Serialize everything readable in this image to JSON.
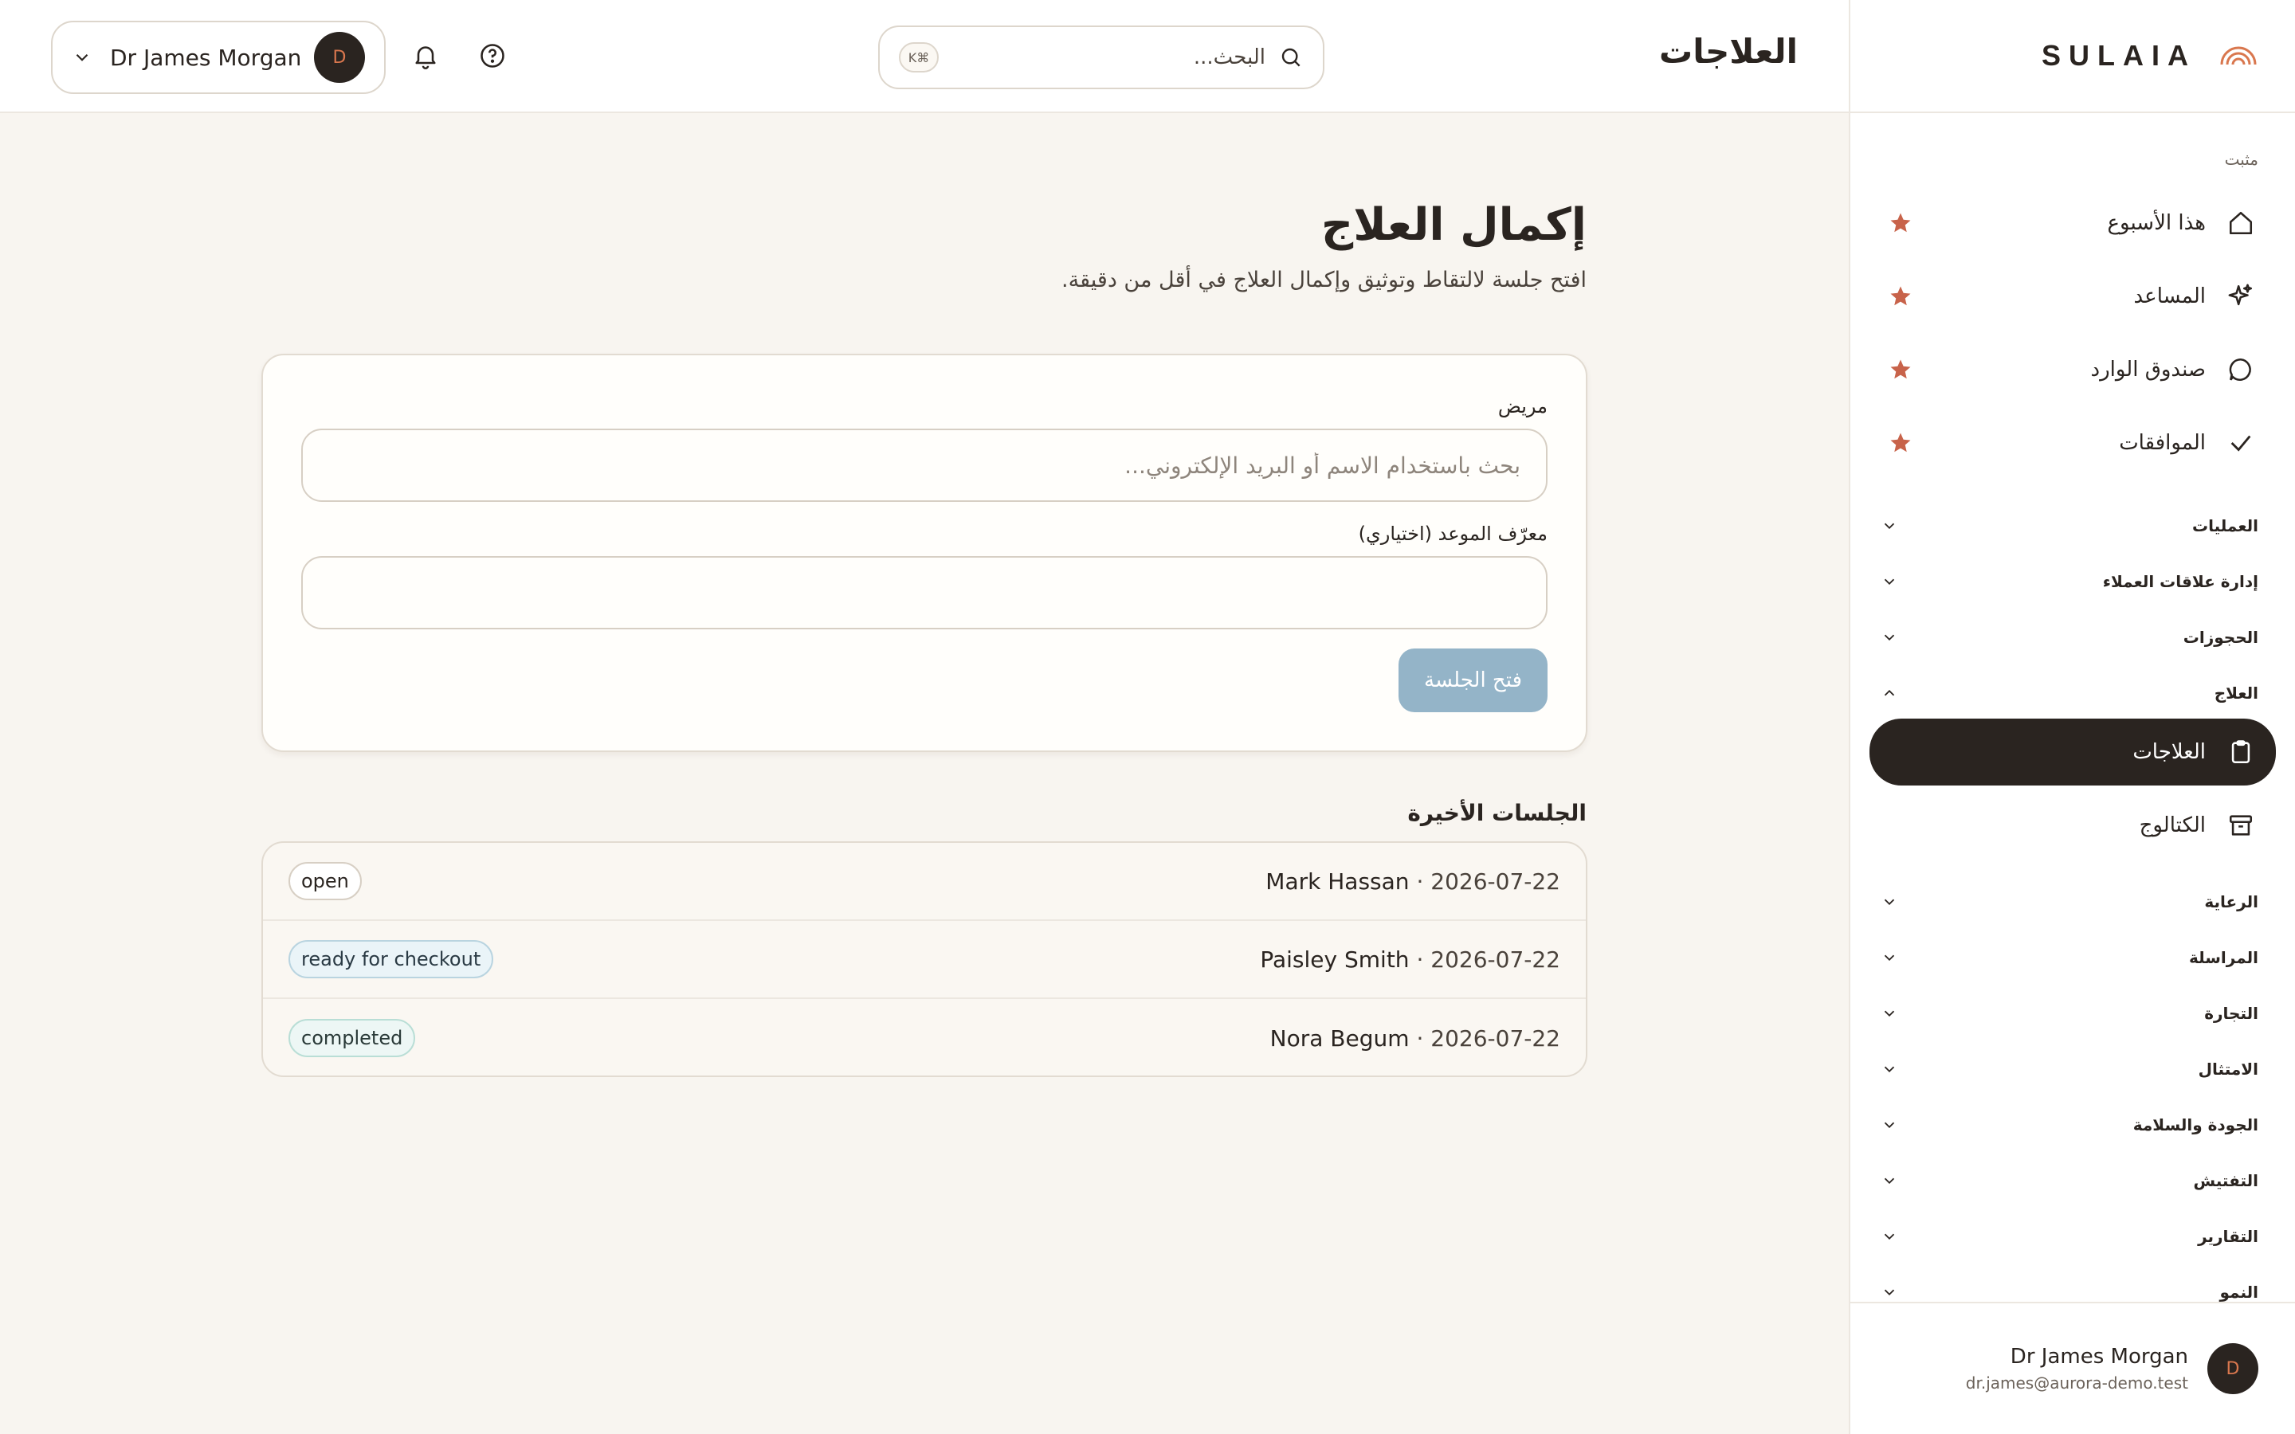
{
  "brand": {
    "name": "SULAIA"
  },
  "sidebar": {
    "pinned_label": "مثبت",
    "pinned_items": [
      {
        "label": "هذا الأسبوع",
        "icon": "home-icon"
      },
      {
        "label": "المساعد",
        "icon": "sparkles-icon"
      },
      {
        "label": "صندوق الوارد",
        "icon": "chat-bubble-icon"
      },
      {
        "label": "الموافقات",
        "icon": "check-icon"
      }
    ],
    "groups": [
      {
        "label": "العمليات"
      },
      {
        "label": "إدارة علاقات العملاء"
      },
      {
        "label": "الحجوزات"
      },
      {
        "label": "العلاج"
      },
      {
        "label": "الرعاية"
      },
      {
        "label": "المراسلة"
      },
      {
        "label": "التجارة"
      },
      {
        "label": "الامتثال"
      },
      {
        "label": "الجودة والسلامة"
      },
      {
        "label": "التفتيش"
      },
      {
        "label": "التقارير"
      },
      {
        "label": "النمو"
      }
    ],
    "treatment_items": [
      {
        "label": "العلاجات",
        "icon": "clipboard-icon",
        "active": true
      },
      {
        "label": "الكتالوج",
        "icon": "archive-box-icon",
        "active": false
      }
    ],
    "footer": {
      "avatar_initial": "D",
      "name": "Dr James Morgan",
      "email": "dr.james@aurora-demo.test"
    }
  },
  "header": {
    "title": "العلاجات",
    "search_placeholder": "البحث...",
    "search_shortcut": "⌘K",
    "user": {
      "name": "Dr James Morgan",
      "avatar_initial": "D"
    }
  },
  "main": {
    "title": "إكمال العلاج",
    "subtitle": "افتح جلسة لالتقاط وتوثيق وإكمال العلاج في أقل من دقيقة.",
    "form": {
      "patient_label": "مريض",
      "patient_placeholder": "بحث باستخدام الاسم أو البريد الإلكتروني...",
      "appointment_label": "معرّف الموعد (اختياري)",
      "appointment_value": "",
      "open_button": "فتح الجلسة"
    },
    "recent": {
      "title": "الجلسات الأخيرة",
      "sessions": [
        {
          "name": "Mark Hassan",
          "date": "2026-07-22",
          "status": "open"
        },
        {
          "name": "Paisley Smith",
          "date": "2026-07-22",
          "status": "ready for checkout"
        },
        {
          "name": "Nora Begum",
          "date": "2026-07-22",
          "status": "completed"
        }
      ]
    }
  },
  "colors": {
    "accent": "#D9774E",
    "dark": "#2A2420",
    "primary_button": "#94B4C8",
    "background": "#F8F5F0"
  }
}
